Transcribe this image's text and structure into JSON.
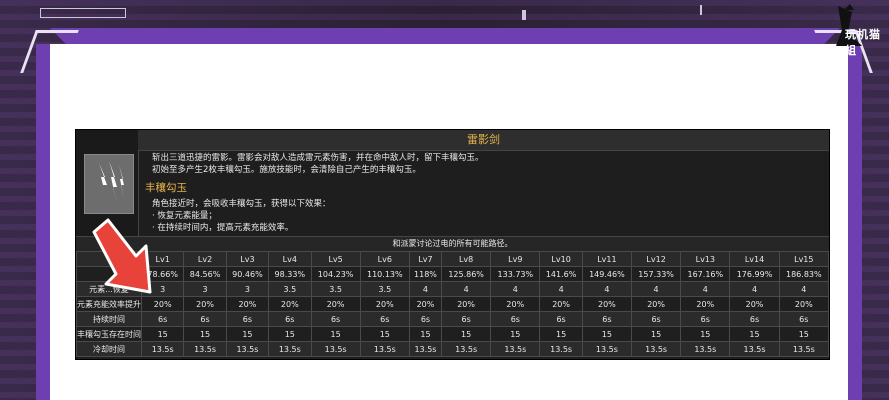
{
  "skill": {
    "name": "雷影剑",
    "description_lines": [
      "斩出三道迅捷的雷影。雷影会对敌人造成雷元素伤害，并在命中敌人时，留下丰穰勾玉。",
      "初始至多产生2枚丰穰勾玉。施放技能时，会清除自己产生的丰穰勾玉。"
    ],
    "passive_title": "丰穰勾玉",
    "passive_lines": [
      "角色接近时，会吸收丰穰勾玉，获得以下效果：",
      "· 恢复元素能量；",
      "· 在持续时间内，提高元素充能效率。"
    ],
    "note": "和派蒙讨论过电的所有可能路径。"
  },
  "table": {
    "levels": [
      "Lv1",
      "Lv2",
      "Lv3",
      "Lv4",
      "Lv5",
      "Lv6",
      "Lv7",
      "Lv8",
      "Lv9",
      "Lv10",
      "Lv11",
      "Lv12",
      "Lv13",
      "Lv14",
      "Lv15"
    ],
    "rows": [
      {
        "label": "",
        "values": [
          "78.66%",
          "84.56%",
          "90.46%",
          "98.33%",
          "104.23%",
          "110.13%",
          "118%",
          "125.86%",
          "133.73%",
          "141.6%",
          "149.46%",
          "157.33%",
          "167.16%",
          "176.99%",
          "186.83%"
        ]
      },
      {
        "label": "元素...恢复",
        "values": [
          "3",
          "3",
          "3",
          "3.5",
          "3.5",
          "3.5",
          "4",
          "4",
          "4",
          "4",
          "4",
          "4",
          "4",
          "4",
          "4"
        ]
      },
      {
        "label": "元素充能效率提升",
        "values": [
          "20%",
          "20%",
          "20%",
          "20%",
          "20%",
          "20%",
          "20%",
          "20%",
          "20%",
          "20%",
          "20%",
          "20%",
          "20%",
          "20%",
          "20%"
        ]
      },
      {
        "label": "持续时间",
        "values": [
          "6s",
          "6s",
          "6s",
          "6s",
          "6s",
          "6s",
          "6s",
          "6s",
          "6s",
          "6s",
          "6s",
          "6s",
          "6s",
          "6s",
          "6s"
        ]
      },
      {
        "label": "丰穰勾玉存在时间",
        "values": [
          "15",
          "15",
          "15",
          "15",
          "15",
          "15",
          "15",
          "15",
          "15",
          "15",
          "15",
          "15",
          "15",
          "15",
          "15"
        ]
      },
      {
        "label": "冷却时间",
        "values": [
          "13.5s",
          "13.5s",
          "13.5s",
          "13.5s",
          "13.5s",
          "13.5s",
          "13.5s",
          "13.5s",
          "13.5s",
          "13.5s",
          "13.5s",
          "13.5s",
          "13.5s",
          "13.5s",
          "13.5s"
        ]
      }
    ]
  },
  "logo_text": "玩机猫組",
  "colors": {
    "frame": "#6e3fb0",
    "title_gold": "#e8b54a",
    "arrow_red": "#e8433a"
  }
}
